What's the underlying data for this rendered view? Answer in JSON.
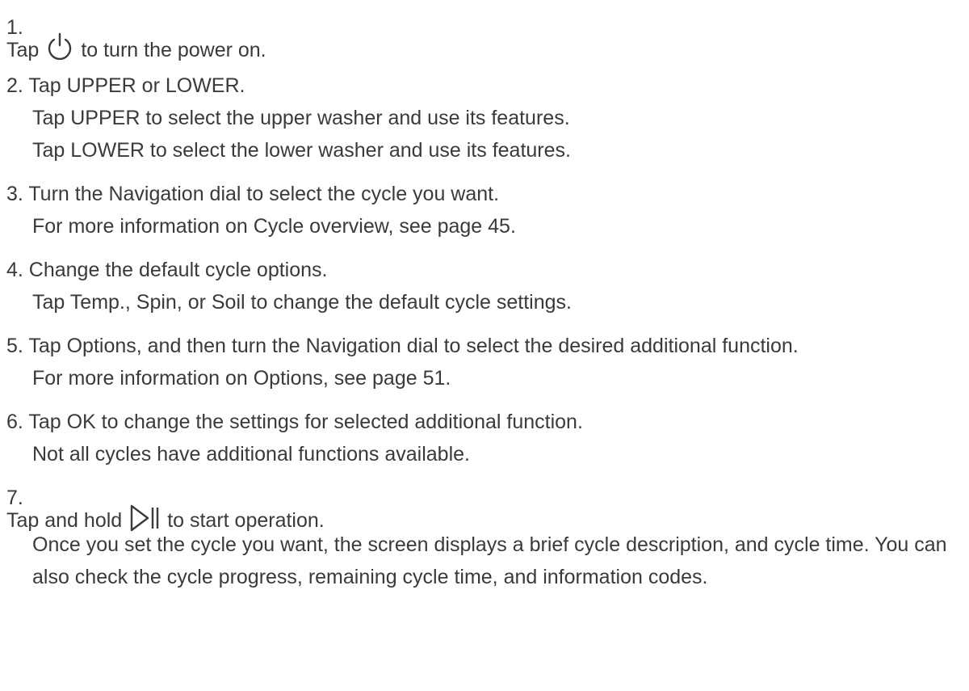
{
  "steps": [
    {
      "number": "1.",
      "before_icon": "Tap",
      "icon": "power-icon",
      "after_icon": "to turn the power on."
    },
    {
      "text": "2. Tap UPPER or LOWER.",
      "details": [
        "Tap UPPER to select the upper washer and use its features.",
        "Tap LOWER to select the lower washer and use its features."
      ]
    },
    {
      "text": "3. Turn the Navigation dial to select the cycle you want.",
      "details": [
        "For more information on Cycle overview, see page 45."
      ]
    },
    {
      "text": "4. Change the default cycle options.",
      "details": [
        "Tap Temp., Spin, or Soil to change the default cycle settings."
      ]
    },
    {
      "text": "5. Tap Options, and then turn the Navigation dial to select the desired additional function.",
      "details": [
        "For more information on Options, see page 51."
      ]
    },
    {
      "text": "6. Tap OK to change the settings for selected additional function.",
      "details": [
        "Not all cycles have additional functions available."
      ]
    },
    {
      "number": "7.",
      "before_icon": "Tap and hold",
      "icon": "start-pause-icon",
      "after_icon": "to start operation.",
      "details": [
        "Once you set the cycle you want, the screen displays a brief cycle description, and cycle time. You can also check the cycle progress, remaining cycle time, and information codes."
      ]
    }
  ]
}
